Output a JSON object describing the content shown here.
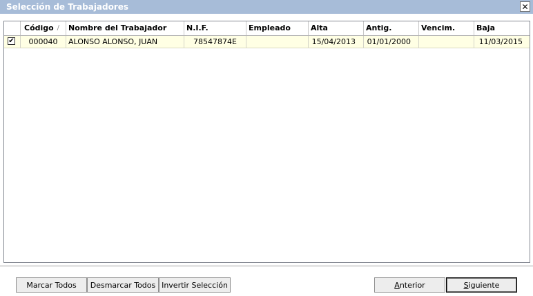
{
  "window": {
    "title": "Selección de Trabajadores",
    "close_label": "✕"
  },
  "grid": {
    "columns": [
      {
        "key": "check",
        "label": ""
      },
      {
        "key": "codigo",
        "label": "Código",
        "sort_indicator": "/"
      },
      {
        "key": "nombre",
        "label": "Nombre del Trabajador"
      },
      {
        "key": "nif",
        "label": "N.I.F."
      },
      {
        "key": "empleado",
        "label": "Empleado"
      },
      {
        "key": "alta",
        "label": "Alta"
      },
      {
        "key": "antig",
        "label": "Antig."
      },
      {
        "key": "vencim",
        "label": "Vencim."
      },
      {
        "key": "baja",
        "label": "Baja"
      }
    ],
    "rows": [
      {
        "checked": "✔",
        "codigo": "000040",
        "nombre": "ALONSO ALONSO, JUAN",
        "nif": "78547874E",
        "empleado": "",
        "alta": "15/04/2013",
        "antig": "01/01/2000",
        "vencim": "",
        "baja": "11/03/2015"
      }
    ]
  },
  "buttons": {
    "marcar_todos": "Marcar Todos",
    "desmarcar_todos": "Desmarcar Todos",
    "invertir_seleccion": "Invertir Selección",
    "anterior_mnemonic": "A",
    "anterior_rest": "nterior",
    "siguiente_mnemonic": "S",
    "siguiente_rest": "iguiente"
  }
}
